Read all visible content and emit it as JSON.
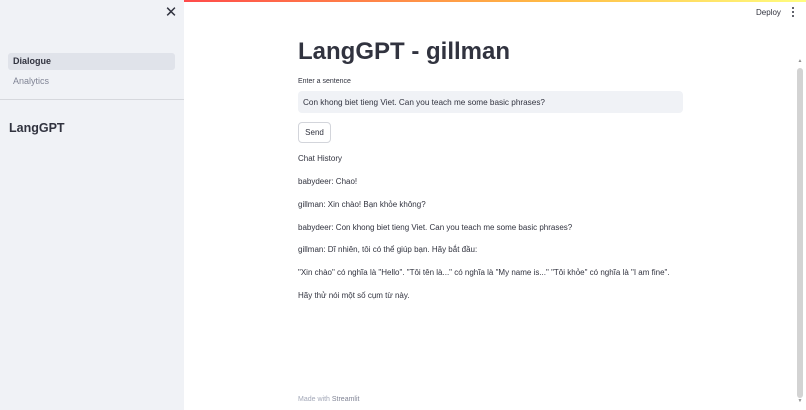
{
  "sidebar": {
    "close_icon": "close-icon",
    "nav": [
      {
        "label": "Dialogue",
        "active": true
      },
      {
        "label": "Analytics",
        "active": false
      }
    ],
    "title": "LangGPT"
  },
  "header": {
    "deploy_label": "Deploy",
    "menu_icon": "vertical-dots-icon",
    "accent_gradient": [
      "#ff4b4b",
      "#ffbd45",
      "#fffd80"
    ]
  },
  "main": {
    "title": "LangGPT - gillman",
    "input_label": "Enter a sentence",
    "input_value": "Con khong biet tieng Viet. Can you teach me some basic phrases?",
    "send_label": "Send",
    "chat_heading": "Chat History",
    "chat_lines": [
      "babydeer: Chao!",
      "gillman: Xin chào! Bạn khỏe không?",
      "babydeer: Con khong biet tieng Viet. Can you teach me some basic phrases?",
      "gillman: Dĩ nhiên, tôi có thể giúp bạn. Hãy bắt đầu:",
      "\"Xin chào\" có nghĩa là \"Hello\". \"Tôi tên là...\" có nghĩa là \"My name is...\" \"Tôi khỏe\" có nghĩa là \"I am fine\".",
      "Hãy thử nói một số cụm từ này."
    ]
  },
  "footer": {
    "prefix": "Made with",
    "brand": "Streamlit"
  }
}
